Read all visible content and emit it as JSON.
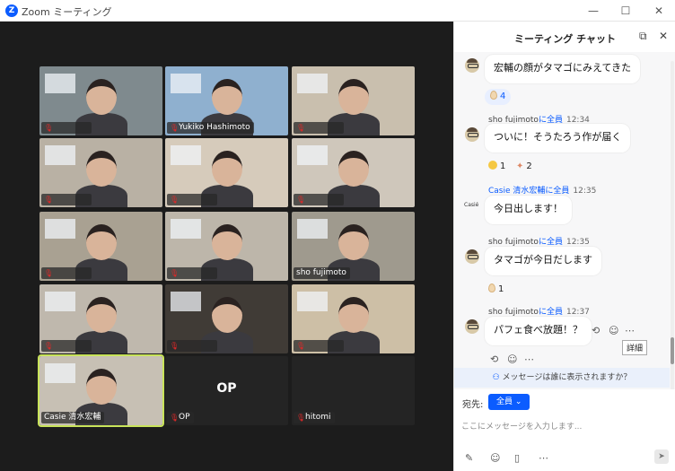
{
  "window": {
    "title": "Zoom ミーティング",
    "logo_letter": "Z",
    "controls": [
      "—",
      "☐",
      "✕"
    ]
  },
  "gallery": [
    {
      "name": "",
      "muted": true,
      "bg": "#7f8a8e"
    },
    {
      "name": "Yukiko Hashimoto",
      "muted": true,
      "bg": "#8fb0cf"
    },
    {
      "name": "",
      "muted": true,
      "bg": "#c9bfae"
    },
    {
      "name": "",
      "muted": true,
      "bg": "#b9b1a4"
    },
    {
      "name": "",
      "muted": true,
      "bg": "#d6cbbb"
    },
    {
      "name": "",
      "muted": true,
      "bg": "#cfc7bb"
    },
    {
      "name": "",
      "muted": true,
      "bg": "#a9a192"
    },
    {
      "name": "",
      "muted": true,
      "bg": "#bdb6aa"
    },
    {
      "name": "sho fujimoto",
      "muted": false,
      "bg": "#9f9a8e"
    },
    {
      "name": "",
      "muted": true,
      "bg": "#bfb8ad"
    },
    {
      "name": "",
      "muted": true,
      "bg": "#403b36"
    },
    {
      "name": "",
      "muted": true,
      "bg": "#cdbfa6"
    },
    {
      "name": "Casie 清水宏輔",
      "muted": false,
      "bg": "#c7c0b4",
      "active": true
    },
    {
      "name": "OP",
      "muted": true,
      "bg": "#242424",
      "placeholder": "OP"
    },
    {
      "name": "hitomi",
      "muted": true,
      "bg": "#242424"
    }
  ],
  "chat": {
    "title": "ミーティング チャット",
    "messages": [
      {
        "sender": "",
        "to": "",
        "time": "",
        "text": "宏輔の顔がタマゴにみえてきた",
        "reactions": [
          {
            "emoji": "egg",
            "count": "4"
          }
        ]
      },
      {
        "sender": "sho fujimoto",
        "to": "に全員",
        "time": "12:34",
        "text": "ついに！そうたろう作が届く",
        "reactions": [
          {
            "emoji": "smile",
            "count": "1"
          },
          {
            "emoji": "party",
            "count": "2"
          }
        ]
      },
      {
        "sender": "Casie 清水宏輔",
        "to": "に全員",
        "time": "12:35",
        "text": "今日出します！",
        "avatar_text": "Casié"
      },
      {
        "sender": "sho fujimoto",
        "to": "に全員",
        "time": "12:35",
        "text": "タマゴが今日だします",
        "reactions": [
          {
            "emoji": "egg",
            "count": "1"
          }
        ]
      },
      {
        "sender": "sho fujimoto",
        "to": "に全員",
        "time": "12:37",
        "text": "パフェ食べ放題！？"
      }
    ],
    "tooltip": "詳細",
    "visibility_note": "メッセージは誰に表示されますか？",
    "to_label": "宛先:",
    "to_value": "全員",
    "input_placeholder": "ここにメッセージを入力します..."
  },
  "colors": {
    "accent": "#0b5cff",
    "active_speaker": "#c8e35a",
    "muted": "#e02828"
  }
}
